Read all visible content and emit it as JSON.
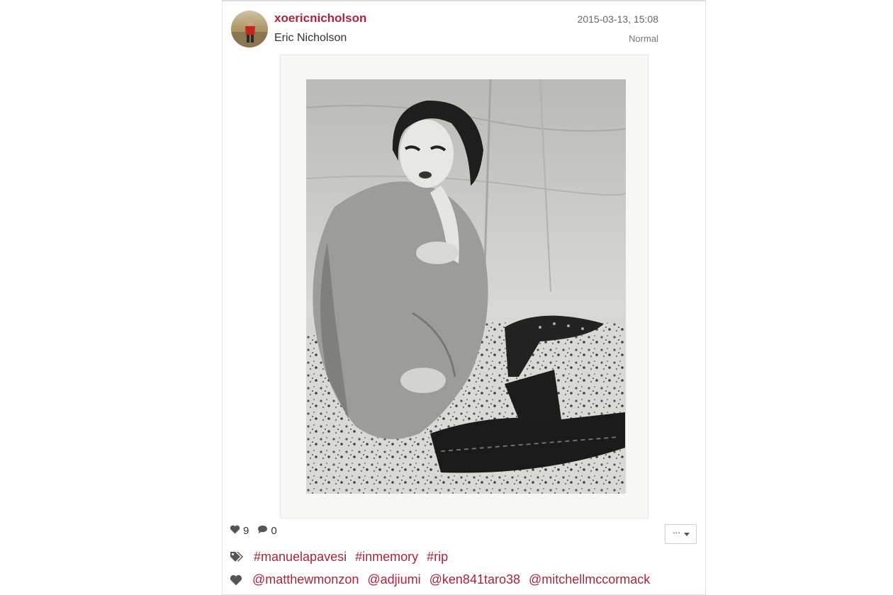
{
  "post": {
    "username": "xoericnicholson",
    "full_name": "Eric Nicholson",
    "timestamp": "2015-03-13, 15:08",
    "filter": "Normal",
    "likes": "9",
    "comments": "0"
  },
  "tags": [
    "#manuelapavesi",
    "#inmemory",
    "#rip"
  ],
  "users": [
    "@matthewmonzon",
    "@adjiumi",
    "@ken841taro38",
    "@mitchellmccormack"
  ],
  "icons": {
    "avatar": "avatar-photo",
    "likes": "heart-icon",
    "comments": "speech-bubble-icon",
    "tags": "tags-icon",
    "users": "heart-icon",
    "more": "ellipsis-icon",
    "caret": "chevron-down-icon"
  },
  "colors": {
    "accent": "#a8253b",
    "text": "#333333",
    "muted": "#666666"
  },
  "actions": {
    "more_label": "···"
  }
}
